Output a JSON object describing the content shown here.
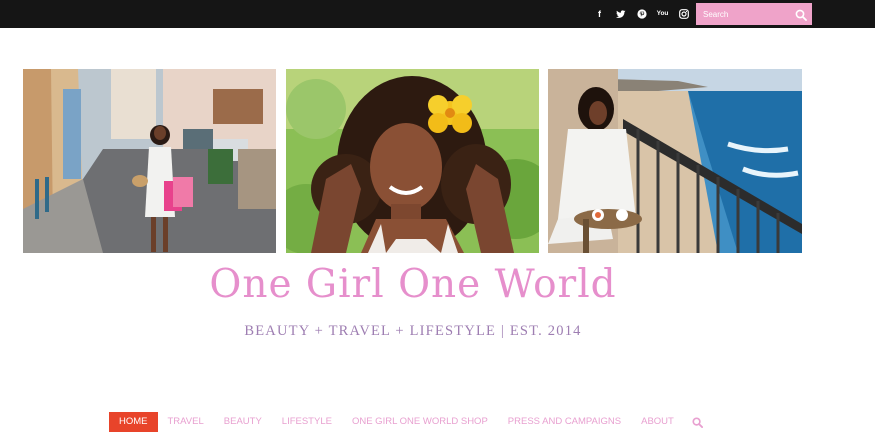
{
  "header": {
    "social_icons": [
      "facebook-icon",
      "twitter-icon",
      "pinterest-icon",
      "youtube-icon",
      "instagram-icon"
    ],
    "social_glyphs": {
      "facebook": "f",
      "youtube": "You"
    },
    "search": {
      "placeholder": "Search",
      "icon": "search-icon"
    }
  },
  "photos": [
    {
      "name": "street-shopping-photo"
    },
    {
      "name": "portrait-flower-photo"
    },
    {
      "name": "balcony-sea-photo"
    }
  ],
  "site": {
    "title": "One Girl One World",
    "tagline": "BEAUTY +  TRAVEL + LIFESTYLE | EST. 2014"
  },
  "nav": {
    "items": [
      "HOME",
      "TRAVEL",
      "BEAUTY",
      "LIFESTYLE",
      "ONE GIRL ONE WORLD SHOP",
      "PRESS AND CAMPAIGNS",
      "ABOUT"
    ],
    "active": "HOME",
    "search_icon": "search-icon"
  },
  "colors": {
    "topbar": "#151515",
    "search_bg": "#efa3c9",
    "title": "#e68fcc",
    "tagline": "#9e7eb2",
    "nav_text": "#e8a0d0",
    "nav_active_bg": "#e8442a"
  }
}
